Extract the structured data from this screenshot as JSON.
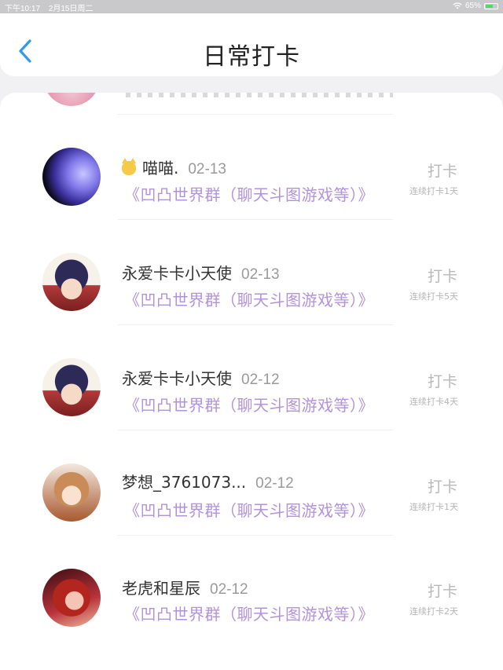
{
  "status_bar": {
    "time": "下午10:17",
    "date": "2月15日周二",
    "battery_text": "65%",
    "battery_level": 0.65,
    "accent_color": "#4cd964"
  },
  "header": {
    "title": "日常打卡",
    "back_icon": "chevron-left-icon",
    "accent_color": "#2f9bea"
  },
  "list": [
    {
      "name": "喵喵.",
      "has_emoji": true,
      "emoji_icon": "cat-face-icon",
      "date": "02-13",
      "group": "《凹凸世界群（聊天斗图游戏等）》",
      "button": "打卡",
      "streak": "连续打卡1天"
    },
    {
      "name": "永爱卡卡小天使",
      "has_emoji": false,
      "date": "02-13",
      "group": "《凹凸世界群（聊天斗图游戏等）》",
      "button": "打卡",
      "streak": "连续打卡5天"
    },
    {
      "name": "永爱卡卡小天使",
      "has_emoji": false,
      "date": "02-12",
      "group": "《凹凸世界群（聊天斗图游戏等）》",
      "button": "打卡",
      "streak": "连续打卡4天"
    },
    {
      "name": "梦想_3761073...",
      "has_emoji": false,
      "date": "02-12",
      "group": "《凹凸世界群（聊天斗图游戏等）》",
      "button": "打卡",
      "streak": "连续打卡1天"
    },
    {
      "name": "老虎和星辰",
      "has_emoji": false,
      "date": "02-12",
      "group": "《凹凸世界群（聊天斗图游戏等）》",
      "button": "打卡",
      "streak": "连续打卡2天"
    }
  ],
  "colors": {
    "group_link": "#b292dd",
    "muted": "#b8b8b8"
  }
}
